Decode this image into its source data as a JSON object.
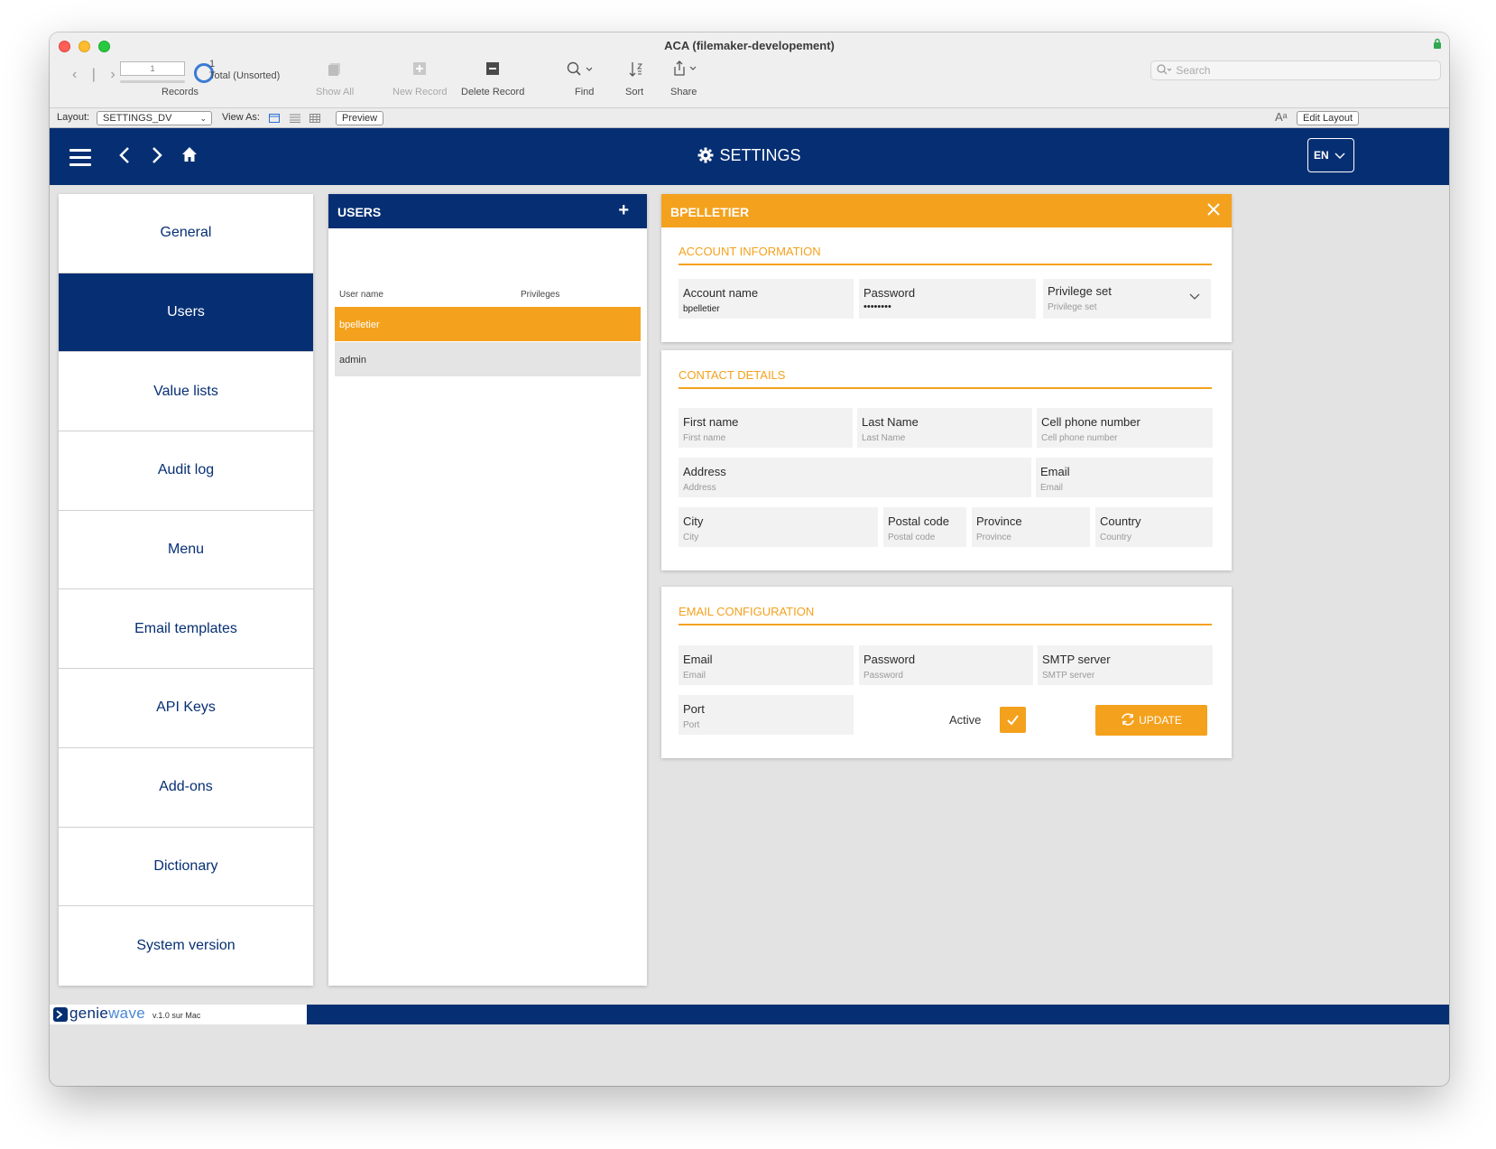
{
  "window": {
    "title": "ACA (filemaker-developement)"
  },
  "toolbar": {
    "record_number": "1",
    "found_count": "1",
    "total_label": "Total (Unsorted)",
    "records_label": "Records",
    "show_all": "Show All",
    "new_record": "New Record",
    "delete_record": "Delete Record",
    "find": "Find",
    "sort": "Sort",
    "share": "Share",
    "search_placeholder": "Search"
  },
  "layoutbar": {
    "layout_label": "Layout:",
    "layout_value": "SETTINGS_DV",
    "view_as_label": "View As:",
    "preview": "Preview",
    "font_size_glyph": "Aᵃ",
    "edit_layout": "Edit Layout"
  },
  "header": {
    "title": "SETTINGS",
    "language": "EN"
  },
  "menu": {
    "items": [
      {
        "label": "General",
        "active": false
      },
      {
        "label": "Users",
        "active": true
      },
      {
        "label": "Value lists",
        "active": false
      },
      {
        "label": "Audit log",
        "active": false
      },
      {
        "label": "Menu",
        "active": false
      },
      {
        "label": "Email templates",
        "active": false
      },
      {
        "label": "API Keys",
        "active": false
      },
      {
        "label": "Add-ons",
        "active": false
      },
      {
        "label": "Dictionary",
        "active": false
      },
      {
        "label": "System version",
        "active": false
      }
    ]
  },
  "users": {
    "title": "USERS",
    "col_username": "User name",
    "col_privileges": "Privileges",
    "rows": [
      {
        "username": "bpelletier",
        "selected": true
      },
      {
        "username": "admin",
        "selected": false
      }
    ]
  },
  "detail": {
    "title": "BPELLETIER",
    "account": {
      "section": "ACCOUNT INFORMATION",
      "account_name_label": "Account name",
      "account_name_value": "bpelletier",
      "password_label": "Password",
      "password_value": "••••••••",
      "privilege_label": "Privilege set",
      "privilege_placeholder": "Privilege set"
    },
    "contact": {
      "section": "CONTACT DETAILS",
      "first_name": "First name",
      "last_name": "Last Name",
      "cell_phone": "Cell phone number",
      "address": "Address",
      "email": "Email",
      "city": "City",
      "postal_code": "Postal code",
      "province": "Province",
      "country": "Country"
    },
    "email_config": {
      "section": "EMAIL CONFIGURATION",
      "email": "Email",
      "password": "Password",
      "smtp": "SMTP server",
      "port": "Port",
      "active_label": "Active",
      "active": true,
      "update": "UPDATE"
    }
  },
  "footer": {
    "brand_genie": "genie",
    "brand_wave": "wave",
    "version": "v.1.0 sur Mac"
  },
  "colors": {
    "navy": "#062f73",
    "orange": "#f4a11d"
  }
}
